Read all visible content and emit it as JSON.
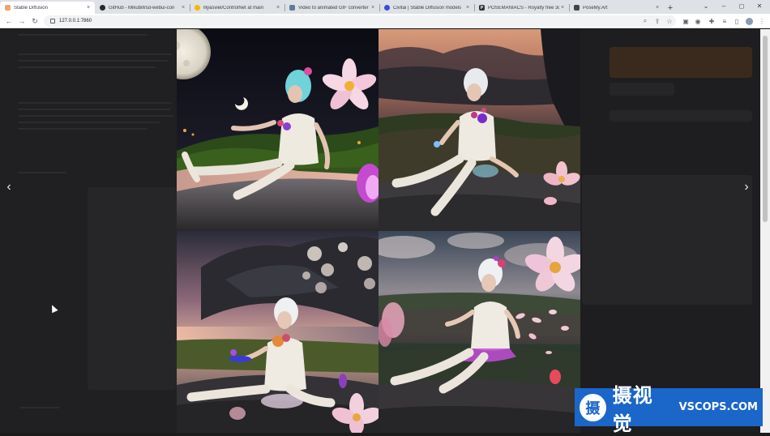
{
  "browser": {
    "tabs": [
      {
        "title": "Stable Diffusion",
        "favicon": "stable-diffusion-icon",
        "color": "#f4a26a",
        "active": true
      },
      {
        "title": "GitHub - Mikubill/sd-webui-con",
        "favicon": "github-icon",
        "color": "#24292f",
        "active": false
      },
      {
        "title": "lllyasviel/ControlNet at main",
        "favicon": "huggingface-icon",
        "color": "#f5b800",
        "active": false
      },
      {
        "title": "Video to animated GIF converter",
        "favicon": "image-icon",
        "color": "#5f7c9a",
        "active": false
      },
      {
        "title": "Civitai | Stable Diffusion models",
        "favicon": "civitai-icon",
        "color": "#3d4bd6",
        "active": false
      },
      {
        "title": "POSEMANIACS - Royalty free 3d",
        "favicon": "posemaniacs-icon",
        "color": "#333333",
        "active": false
      },
      {
        "title": "PoseMy.Art",
        "favicon": "posemy-art-icon",
        "color": "#444444",
        "active": false
      }
    ],
    "new_tab_symbol": "+",
    "close_symbol": "×",
    "url": "127.0.0.1:7860"
  },
  "gallery": {
    "prev_symbol": "‹",
    "next_symbol": "›",
    "images": [
      {
        "name": "generated-image-1"
      },
      {
        "name": "generated-image-2"
      },
      {
        "name": "generated-image-3"
      },
      {
        "name": "generated-image-4"
      }
    ]
  },
  "watermark": {
    "logo_char": "摄",
    "cn_text": "摄视觉",
    "en_text": "VSCOPS.COM",
    "color": "#1a66c9"
  }
}
